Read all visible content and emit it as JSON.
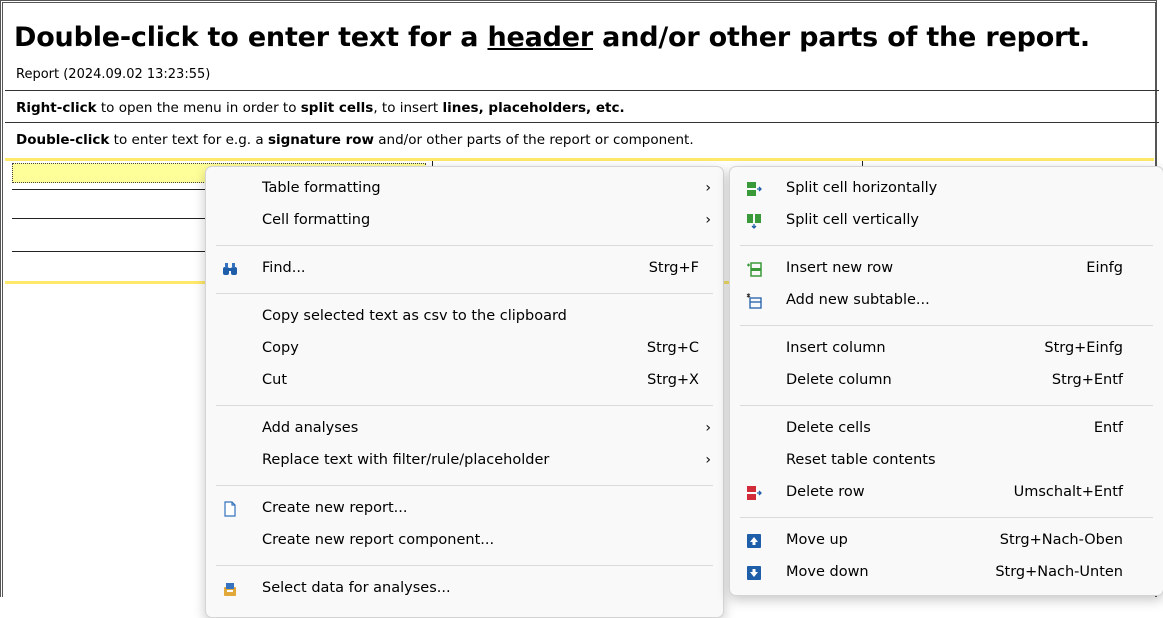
{
  "report": {
    "headline_pre": "Double-click to enter text for a ",
    "headline_u": "header",
    "headline_post": " and/or other parts of the report.",
    "subline": "Report (2024.09.02 13:23:55)",
    "note1_b1": "Right-click",
    "note1_t1": " to open the menu in order to ",
    "note1_b2": "split cells",
    "note1_t2": ", to insert ",
    "note1_b3": "lines, placeholders, etc.",
    "note2_b1": "Double-click",
    "note2_t1": " to enter text for e.g. a ",
    "note2_b2": "signature row",
    "note2_t2": " and/or other parts of the report or component."
  },
  "menu_main": {
    "items": [
      {
        "label": "Table formatting",
        "shortcut": "",
        "submenu": "›"
      },
      {
        "label": "Cell formatting",
        "shortcut": "",
        "submenu": "›"
      },
      {
        "label": "Find...",
        "shortcut": "Strg+F",
        "icon": "binoculars-icon"
      },
      {
        "label": "Copy selected text as csv to the clipboard",
        "shortcut": ""
      },
      {
        "label": "Copy",
        "shortcut": "Strg+C"
      },
      {
        "label": "Cut",
        "shortcut": "Strg+X"
      },
      {
        "label": "Add analyses",
        "shortcut": "",
        "submenu": "›"
      },
      {
        "label": "Replace text with filter/rule/placeholder",
        "shortcut": "",
        "submenu": "›"
      },
      {
        "label": "Create new report...",
        "shortcut": "",
        "icon": "document-icon"
      },
      {
        "label": "Create new report component...",
        "shortcut": ""
      },
      {
        "label": "Select data for analyses...",
        "shortcut": "",
        "icon": "database-icon"
      }
    ]
  },
  "menu_sub": {
    "items": [
      {
        "label": "Split cell horizontally",
        "shortcut": "",
        "icon": "split-horizontal-icon"
      },
      {
        "label": "Split cell vertically",
        "shortcut": "",
        "icon": "split-vertical-icon"
      },
      {
        "label": "Insert new row",
        "shortcut": "Einfg",
        "icon": "insert-row-icon"
      },
      {
        "label": "Add new subtable...",
        "shortcut": "",
        "icon": "subtable-icon"
      },
      {
        "label": "Insert column",
        "shortcut": "Strg+Einfg"
      },
      {
        "label": "Delete column",
        "shortcut": "Strg+Entf"
      },
      {
        "label": "Delete cells",
        "shortcut": "Entf"
      },
      {
        "label": "Reset table contents",
        "shortcut": ""
      },
      {
        "label": "Delete row",
        "shortcut": "Umschalt+Entf",
        "icon": "delete-row-icon"
      },
      {
        "label": "Move up",
        "shortcut": "Strg+Nach-Oben",
        "icon": "move-up-icon"
      },
      {
        "label": "Move down",
        "shortcut": "Strg+Nach-Unten",
        "icon": "move-down-icon"
      }
    ]
  },
  "colors": {
    "accent_yellow": "#ffff99",
    "green": "#3a9a3a",
    "red": "#d22b3a",
    "blue": "#1f5ea8"
  }
}
